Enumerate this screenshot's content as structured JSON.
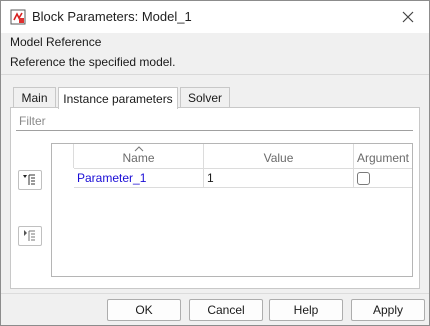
{
  "window": {
    "title": "Block Parameters: Model_1"
  },
  "header": {
    "section_title": "Model Reference",
    "description": "Reference the specified model."
  },
  "tabs": [
    {
      "label": "Main",
      "active": false
    },
    {
      "label": "Instance parameters",
      "active": true
    },
    {
      "label": "Solver",
      "active": false
    }
  ],
  "filter": {
    "placeholder": "Filter",
    "value": ""
  },
  "table": {
    "columns": [
      "Name",
      "Value",
      "Argument"
    ],
    "sort_column": "Name",
    "rows": [
      {
        "name": "Parameter_1",
        "value": "1",
        "argument": false
      }
    ]
  },
  "buttons": {
    "ok": "OK",
    "cancel": "Cancel",
    "help": "Help",
    "apply": "Apply"
  },
  "colors": {
    "link": "#1a0dd6",
    "border": "#b5b5b5",
    "background": "#f0f0f0"
  },
  "icons": {
    "app": "simulink-block-icon",
    "close": "close-icon",
    "side_top": "tree-expand-icon",
    "side_bottom": "tree-collapse-icon"
  }
}
